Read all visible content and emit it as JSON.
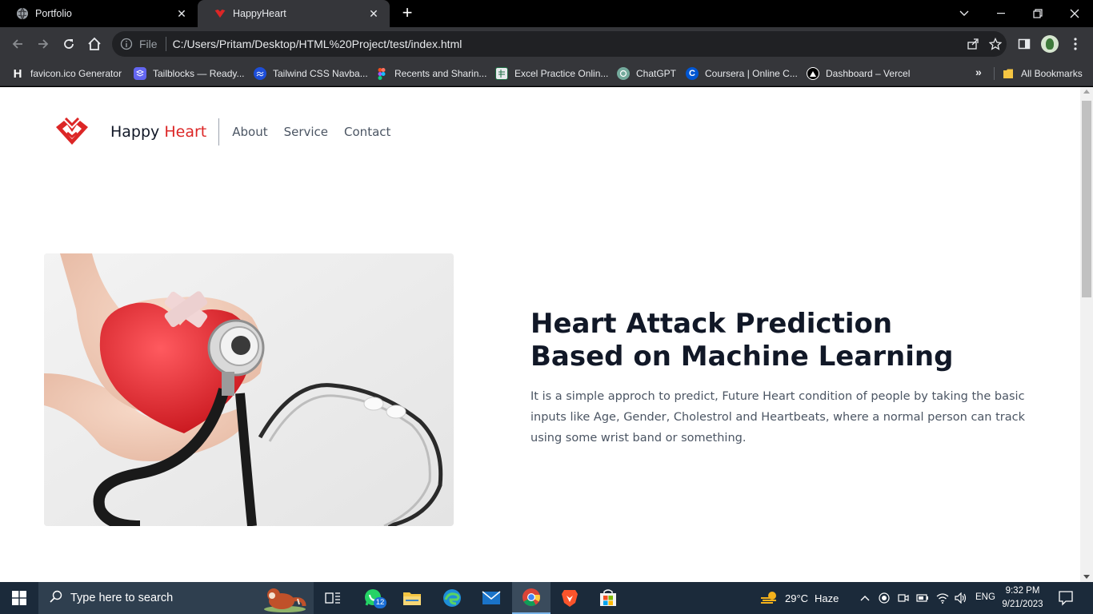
{
  "browser": {
    "tabs": [
      {
        "title": "Portfolio",
        "active": false
      },
      {
        "title": "HappyHeart",
        "active": true
      }
    ],
    "omnibox": {
      "scheme": "File",
      "url": "C:/Users/Pritam/Desktop/HTML%20Project/test/index.html"
    },
    "bookmarks": [
      {
        "label": "favicon.ico Generator",
        "icon": "h-letter-icon"
      },
      {
        "label": "Tailblocks — Ready...",
        "icon": "tailblocks-icon"
      },
      {
        "label": "Tailwind CSS Navba...",
        "icon": "tailwind-icon"
      },
      {
        "label": "Recents and Sharin...",
        "icon": "figma-icon"
      },
      {
        "label": "Excel Practice Onlin...",
        "icon": "excel-icon"
      },
      {
        "label": "ChatGPT",
        "icon": "chatgpt-icon"
      },
      {
        "label": "Coursera | Online C...",
        "icon": "coursera-icon"
      },
      {
        "label": "Dashboard – Vercel",
        "icon": "vercel-icon"
      }
    ],
    "all_bookmarks_label": "All Bookmarks"
  },
  "site": {
    "brand": {
      "part1": "Happy",
      "part2": "Heart"
    },
    "nav": [
      "About",
      "Service",
      "Contact"
    ],
    "hero": {
      "title_line1": "Heart Attack Prediction",
      "title_line2": "Based on Machine Learning",
      "description": "It is a simple approch to predict, Future Heart condition of people by taking the basic inputs like Age, Gender, Cholestrol and Heartbeats, where a normal person can track using some wrist band or something."
    }
  },
  "taskbar": {
    "search_placeholder": "Type here to search",
    "whatsapp_badge": "12",
    "weather": {
      "temp": "29°C",
      "condition": "Haze"
    },
    "language": "ENG",
    "time": "9:32 PM",
    "date": "9/21/2023"
  },
  "colors": {
    "brand_red": "#dc2626",
    "text_dark": "#111827",
    "text_muted": "#4b5563",
    "chrome_dark": "#35363a"
  }
}
